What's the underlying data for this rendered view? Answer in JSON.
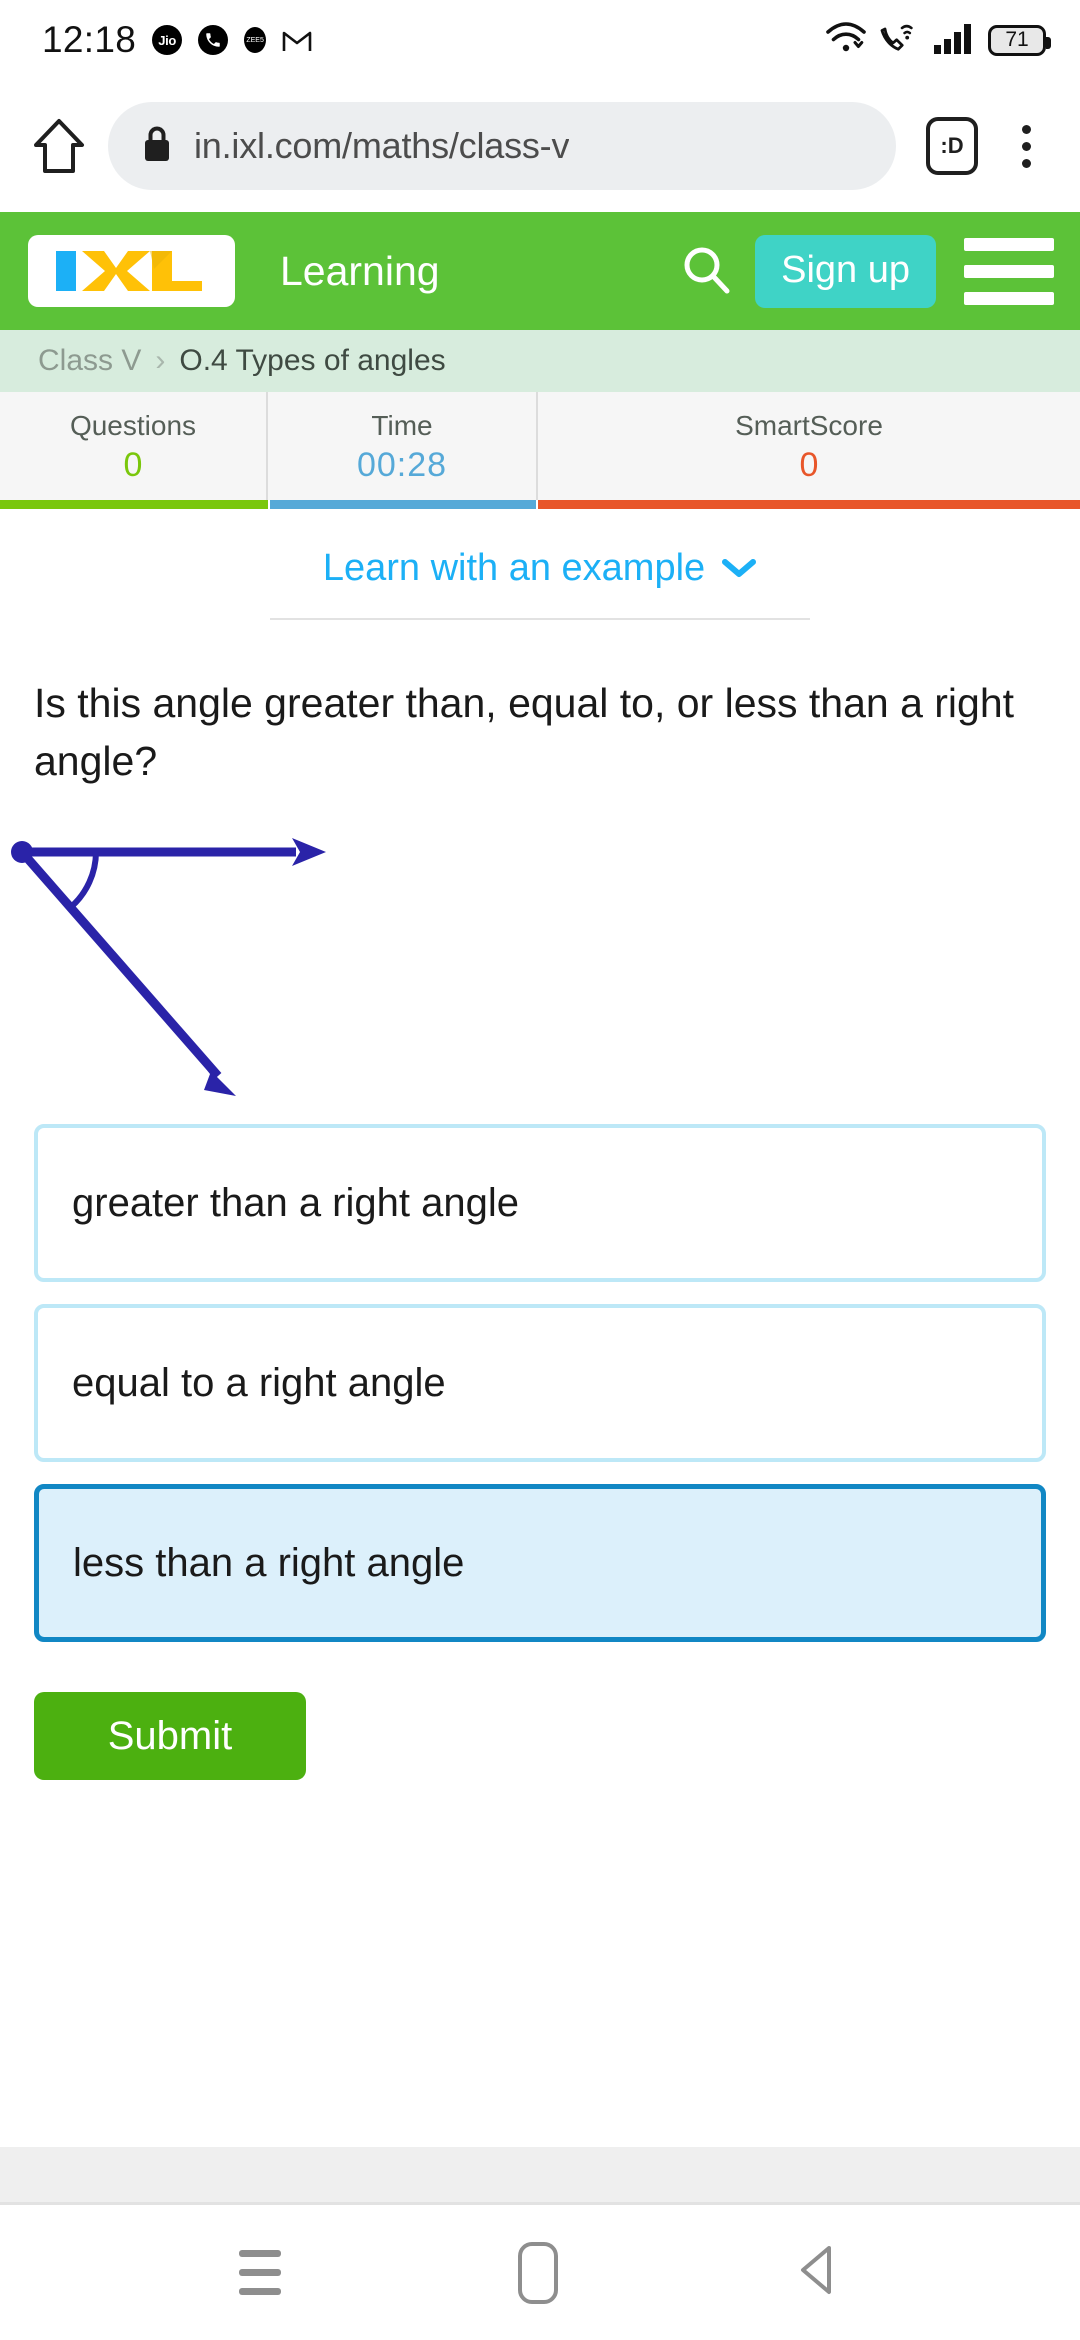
{
  "status_bar": {
    "time": "12:18",
    "icons_left": [
      "jio-icon",
      "phone-icon",
      "zee5-icon",
      "gmail-icon"
    ],
    "jio_label": "Jio",
    "zee_label": "ZEE5",
    "icons_right": [
      "wifi-icon",
      "vowifi-call-icon",
      "signal-bars-icon"
    ],
    "battery_percent": "71"
  },
  "browser": {
    "home_icon": "home-icon",
    "lock_icon": "lock-icon",
    "url": "in.ixl.com/maths/class-v",
    "tab_count": ":D",
    "menu_icon": "overflow-menu-icon"
  },
  "ixl_header": {
    "logo_text": "IXL",
    "logo_colors": {
      "i": "#1cb0f6",
      "x": "#ffc107",
      "l": "#ffc107"
    },
    "nav_label": "Learning",
    "search_icon": "search-icon",
    "signup_label": "Sign up",
    "signup_color": "#3fd3c6",
    "menu_icon": "hamburger-menu-icon",
    "background": "#5cc238"
  },
  "breadcrumb": {
    "parent": "Class V",
    "separator": "›",
    "current": "O.4 Types of angles"
  },
  "stats": {
    "items": [
      {
        "label": "Questions",
        "value": "0",
        "color": "#7ac70c"
      },
      {
        "label": "Time",
        "value": "00:28",
        "color": "#56a9d8"
      },
      {
        "label": "SmartScore",
        "value": "0",
        "color": "#e8562a"
      }
    ]
  },
  "main": {
    "learn_link": "Learn with an example",
    "learn_chevron": "chevron-down-icon",
    "question": "Is this angle greater than, equal to, or less than a right angle?",
    "figure": {
      "name": "angle-diagram",
      "stroke_color": "#2a23a8",
      "description": "acute angle with vertex at left, one horizontal ray and one descending ray, arc marking"
    },
    "options": [
      {
        "label": "greater than a right angle",
        "selected": false
      },
      {
        "label": "equal to a right angle",
        "selected": false
      },
      {
        "label": "less than a right angle",
        "selected": true
      }
    ],
    "submit_label": "Submit",
    "submit_color": "#4cb010"
  },
  "navbar": {
    "recent_icon": "recent-apps-icon",
    "home_icon": "home-pill-icon",
    "back_icon": "back-triangle-icon"
  }
}
